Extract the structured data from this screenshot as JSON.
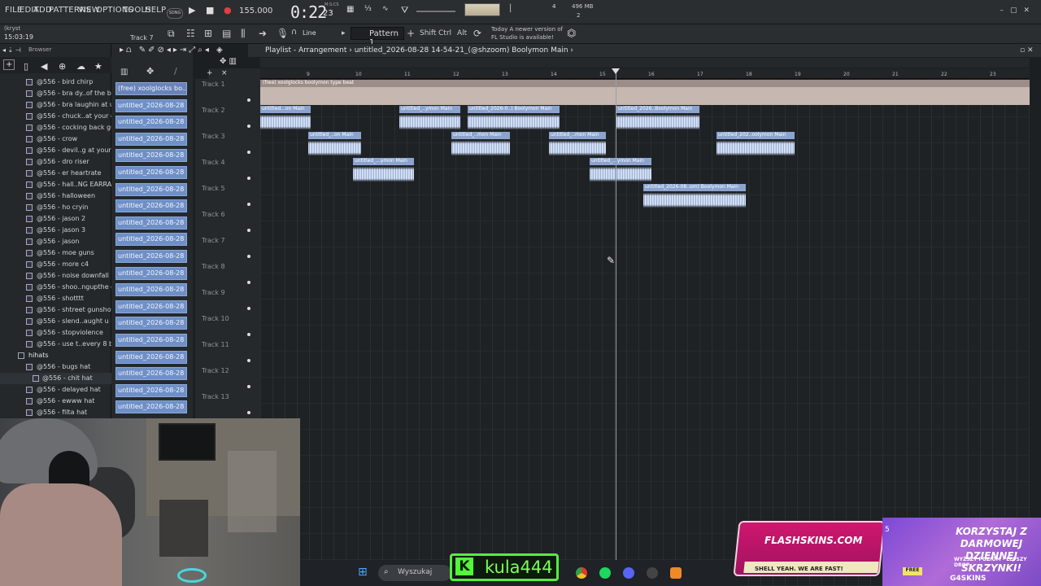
{
  "menu": [
    "FILE",
    "EDIT",
    "ADD",
    "PATTERNS",
    "VIEW",
    "OPTIONS",
    "TOOLS",
    "HELP"
  ],
  "transport": {
    "mode": "SONG",
    "tempo": "155.000",
    "time_main": "0:22",
    "time_sub": "23",
    "time_unit": "M:S:CS",
    "cpu": "496 MB",
    "voices": "2",
    "beats": "4"
  },
  "hint": "(kryst",
  "clock": "15:03:19",
  "current_track": "Track 7",
  "snap": "Line",
  "pattern": "Pattern 1",
  "keys": [
    "Shift",
    "Ctrl",
    "Alt"
  ],
  "news": "Today  A newer version of FL Studio is available!",
  "browser": {
    "title": "Browser",
    "items": [
      {
        "label": "@556 - bird chirp",
        "type": "file"
      },
      {
        "label": "@556 - bra dy..of the beat",
        "type": "file"
      },
      {
        "label": "@556 - bra laughin at u",
        "type": "file"
      },
      {
        "label": "@556 - chuck..at your cut",
        "type": "file"
      },
      {
        "label": "@556 - cocking back gun",
        "type": "file"
      },
      {
        "label": "@556 - crow",
        "type": "file"
      },
      {
        "label": "@556 - devil..g at your cut",
        "type": "file"
      },
      {
        "label": "@556 - dro riser",
        "type": "file"
      },
      {
        "label": "@556 - er heartrate",
        "type": "file"
      },
      {
        "label": "@556 - hall..NG EARRAPE)",
        "type": "file"
      },
      {
        "label": "@556 - halloween",
        "type": "file"
      },
      {
        "label": "@556 - ho cryin",
        "type": "file"
      },
      {
        "label": "@556 - jason 2",
        "type": "file"
      },
      {
        "label": "@556 - jason 3",
        "type": "file"
      },
      {
        "label": "@556 - jason",
        "type": "file"
      },
      {
        "label": "@556 - moe guns",
        "type": "file"
      },
      {
        "label": "@556 - more c4",
        "type": "file"
      },
      {
        "label": "@556 - noise downfall",
        "type": "file"
      },
      {
        "label": "@556 - shoo..ngupthe club",
        "type": "file"
      },
      {
        "label": "@556 - shotttt",
        "type": "file"
      },
      {
        "label": "@556 - shtreet gunshot",
        "type": "file"
      },
      {
        "label": "@556 - slend..aught u bro",
        "type": "file"
      },
      {
        "label": "@556 - stopviolence",
        "type": "file"
      },
      {
        "label": "@556 - use t..every 8 bars",
        "type": "file"
      },
      {
        "label": "hihats",
        "type": "folder"
      },
      {
        "label": "@556 - bugs hat",
        "type": "file"
      },
      {
        "label": "@556 - chit hat",
        "type": "sub"
      },
      {
        "label": "@556 - delayed hat",
        "type": "file"
      },
      {
        "label": "@556 - ewww hat",
        "type": "file"
      },
      {
        "label": "@556 - filta hat",
        "type": "file"
      }
    ]
  },
  "patterns": [
    "(free) xoolglocks bo...",
    "untitled_2026-08-28 14-",
    "untitled_2026-08-28 14-",
    "untitled_2026-08-28 14-",
    "untitled_2026-08-28 14-",
    "untitled_2026-08-28 14-",
    "untitled_2026-08-28 14-",
    "untitled_2026-08-28 14-",
    "untitled_2026-08-28 14-",
    "untitled_2026-08-28 14-",
    "untitled_2026-08-28 14-",
    "untitled_2026-08-28 14-",
    "untitled_2026-08-28 14-",
    "untitled_2026-08-28 14-",
    "untitled_2026-08-28 14-",
    "untitled_2026-08-28 14-",
    "untitled_2026-08-28 14-",
    "untitled_2026-08-28 14-",
    "untitled_2026-08-28 14-",
    "untitled_2026-08-28 14-"
  ],
  "playlist": {
    "title": "Playlist - Arrangement",
    "project": "untitled_2026-08-28 14-54-21_(@shzoom) Boolymon Main",
    "bars": [
      "9",
      "10",
      "11",
      "12",
      "13",
      "14",
      "15",
      "16",
      "17",
      "18",
      "19",
      "20",
      "21",
      "22",
      "23"
    ],
    "tracks": [
      "Track 1",
      "Track 2",
      "Track 3",
      "Track 4",
      "Track 5",
      "Track 6",
      "Track 7",
      "Track 8",
      "Track 9",
      "Track 10",
      "Track 11",
      "Track 12",
      "Track 13"
    ],
    "main_clip": "(free) xoolglocks boolymon type beat",
    "clip_labels": [
      "untitled...on Main",
      "untitled_..ymon Main",
      "untitled_2026-0..) Boolymon Main",
      "untitled_2026..Boolymon Main",
      "untitled_..on Main",
      "untitled_..mon Main",
      "untitled_..mon Main",
      "untitled_202..oolymon Main",
      "untitled_...ymon Main",
      "untitled_...ymon Main",
      "untitled_2026-08..om) Boolymon Main"
    ]
  },
  "taskbar": {
    "search": "Wyszukaj"
  },
  "overlay": {
    "kick_name": "kula444"
  },
  "ads": {
    "ad1_title": "FLASHSKINS.COM",
    "ad1_sub": "SHELL YEAH. WE ARE FAST!",
    "ad2_title": "KORZYSTAJ Z DARMOWEJ DZIENNEJ SKRZYNKI!",
    "ad2_sub": "WYŻSZY POZIOM - LEPSZY DROP",
    "ad2_free": "FREE",
    "ad2_logo": "G4SKINS",
    "ad2_num": "5"
  }
}
